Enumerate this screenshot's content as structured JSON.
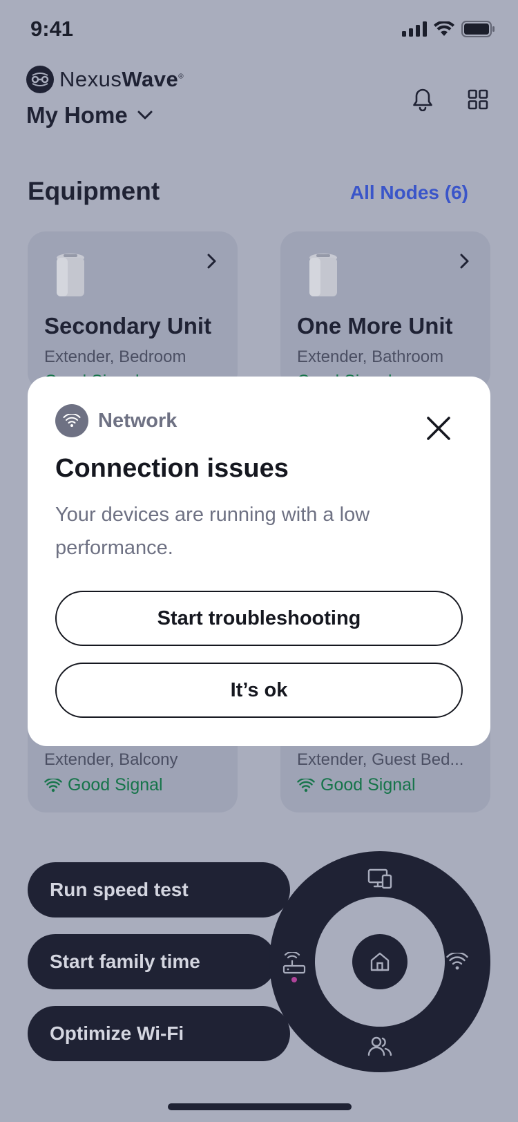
{
  "status_bar": {
    "time": "9:41"
  },
  "header": {
    "brand_light": "Nexus",
    "brand_bold": "Wave",
    "brand_mark": "®",
    "home_name": "My Home"
  },
  "equipment": {
    "title": "Equipment",
    "all_nodes_link": "All Nodes (6)",
    "cards": [
      {
        "name": "Secondary Unit",
        "subtitle": "Extender, Bedroom",
        "signal": "Good Signal"
      },
      {
        "name": "One More Unit",
        "subtitle": "Extender, Bathroom",
        "signal": "Good Signal"
      },
      {
        "name": "",
        "subtitle": "Extender, Balcony",
        "signal": "Good Signal"
      },
      {
        "name": "",
        "subtitle": "Extender, Guest Bed...",
        "signal": "Good Signal"
      }
    ]
  },
  "actions": {
    "speed_test": "Run speed test",
    "family_time": "Start family time",
    "optimize": "Optimize Wi-Fi"
  },
  "modal": {
    "category": "Network",
    "title": "Connection issues",
    "body": "Your devices are running with a low performance.",
    "primary_button": "Start troubleshooting",
    "secondary_button": "It’s ok"
  },
  "colors": {
    "background": "#a9adbd",
    "dark": "#1f2234",
    "accent_link": "#3a55c9",
    "signal_good": "#16744a",
    "alert_dot": "#b0449a"
  }
}
